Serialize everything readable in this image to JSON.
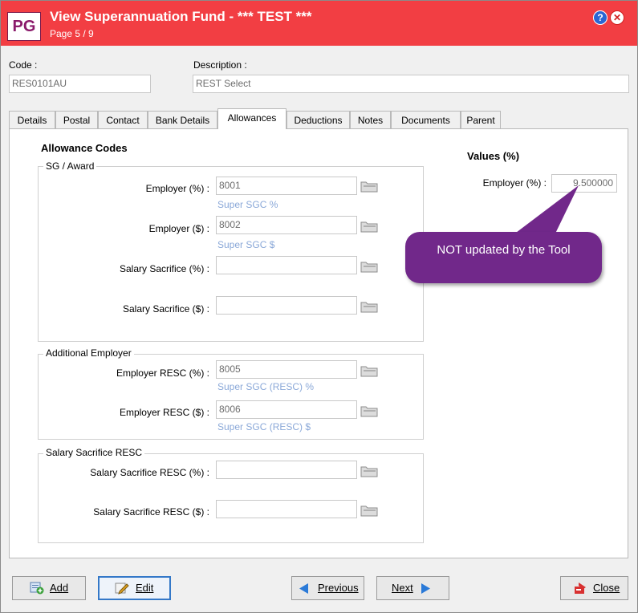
{
  "window": {
    "logo": "PG",
    "title": "View Superannuation Fund - *** TEST ***",
    "page_indicator": "Page 5 / 9"
  },
  "header": {
    "code_label": "Code :",
    "code_value": "RES0101AU",
    "description_label": "Description :",
    "description_value": "REST Select"
  },
  "tabs": [
    "Details",
    "Postal",
    "Contact",
    "Bank Details",
    "Allowances",
    "Deductions",
    "Notes",
    "Documents",
    "Parent"
  ],
  "active_tab": "Allowances",
  "allowances": {
    "heading": "Allowance Codes",
    "sg_award": {
      "title": "SG / Award",
      "employer_pct": {
        "label": "Employer (%) :",
        "value": "8001",
        "hint": "Super SGC %"
      },
      "employer_amt": {
        "label": "Employer ($) :",
        "value": "8002",
        "hint": "Super SGC $"
      },
      "salary_sacrifice_pct": {
        "label": "Salary Sacrifice (%) :",
        "value": ""
      },
      "salary_sacrifice_amt": {
        "label": "Salary Sacrifice ($) :",
        "value": ""
      }
    },
    "additional_employer": {
      "title": "Additional Employer",
      "resc_pct": {
        "label": "Employer RESC (%) :",
        "value": "8005",
        "hint": "Super SGC (RESC) %"
      },
      "resc_amt": {
        "label": "Employer RESC ($) :",
        "value": "8006",
        "hint": "Super SGC (RESC) $"
      }
    },
    "salary_sacrifice_resc": {
      "title": "Salary Sacrifice RESC",
      "resc_pct": {
        "label": "Salary Sacrifice RESC (%) :",
        "value": ""
      },
      "resc_amt": {
        "label": "Salary Sacrifice RESC ($) :",
        "value": ""
      }
    }
  },
  "values": {
    "heading": "Values (%)",
    "employer_label": "Employer (%) :",
    "employer_value": "9.500000"
  },
  "callout": {
    "text": "NOT updated by the Tool",
    "color": "#71288a"
  },
  "buttons": {
    "add": "Add",
    "edit": "Edit",
    "previous": "Previous",
    "next": "Next",
    "close": "Close"
  },
  "colors": {
    "titlebar": "#f23e43",
    "hint_text": "#8aa8d8",
    "accent_blue": "#3478c8"
  }
}
